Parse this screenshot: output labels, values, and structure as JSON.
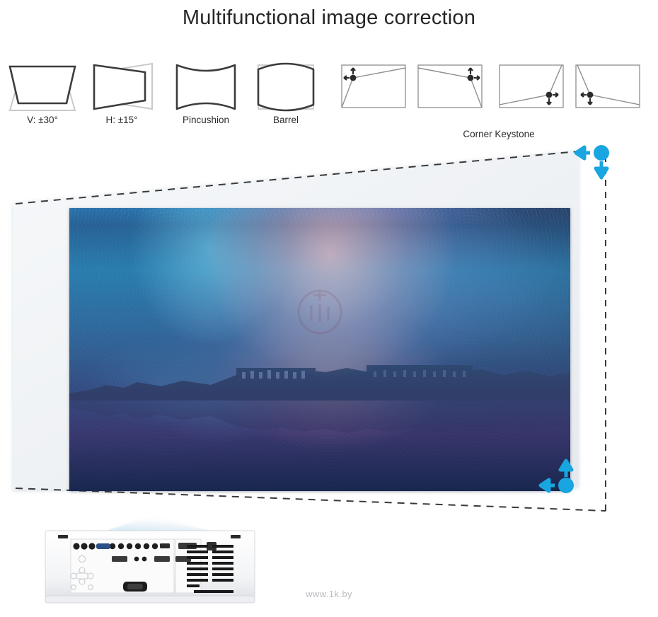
{
  "page": {
    "title": "Multifunctional image correction",
    "watermark": "www.1k.by",
    "background": "#ffffff",
    "accent_blue": "#18a5e0",
    "title_color": "#262626"
  },
  "correction_icons": [
    {
      "id": "vertical-keystone",
      "label": "V: ±30°",
      "shape": "trapezoid-vertical"
    },
    {
      "id": "horizontal-keystone",
      "label": "H: ±15°",
      "shape": "trapezoid-horizontal"
    },
    {
      "id": "pincushion",
      "label": "Pincushion",
      "shape": "pincushion"
    },
    {
      "id": "barrel",
      "label": "Barrel",
      "shape": "barrel"
    },
    {
      "id": "corner-top-left",
      "label": "",
      "shape": "corner-tl"
    },
    {
      "id": "corner-top-right",
      "label": "",
      "shape": "corner-tr"
    },
    {
      "id": "corner-bottom-right",
      "label": "",
      "shape": "corner-br"
    },
    {
      "id": "corner-bottom-left",
      "label": "",
      "shape": "corner-bl"
    }
  ],
  "group_labels": {
    "corner_keystone": "Corner Keystone"
  },
  "projection": {
    "screen_fill": "#f2f4f6",
    "outline_style": "dashed",
    "outline_color": "#3a3a3a",
    "photo_alt": "Night sky milky way over a lakeside city skyline reflected in water",
    "photo_watermark_shape": "circle-monogram"
  },
  "adjust_handles": [
    {
      "id": "handle-top-right",
      "arrows": [
        "left",
        "down"
      ],
      "color": "#18a5e0"
    },
    {
      "id": "handle-bottom-right",
      "arrows": [
        "up",
        "left"
      ],
      "color": "#18a5e0"
    }
  ],
  "device": {
    "name": "projector-rear-panel",
    "body_color": "#f4f5f7",
    "vent_color": "#1a1a1a"
  }
}
